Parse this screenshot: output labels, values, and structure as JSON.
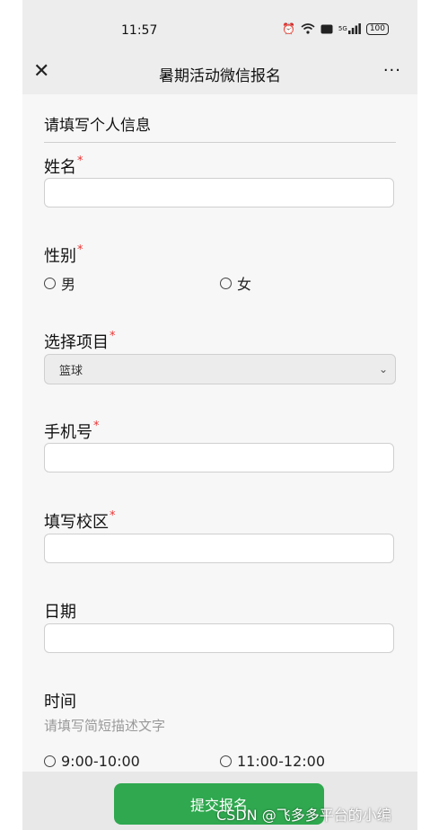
{
  "status": {
    "time": "11:57",
    "battery": "100",
    "icons": [
      "alarm-icon",
      "wifi-icon",
      "hd-icon",
      "signal-icon",
      "battery-icon"
    ],
    "signal_text": "5G"
  },
  "navbar": {
    "close_icon": "close-icon",
    "title": "暑期活动微信报名",
    "more_icon": "more-icon",
    "more_glyph": "···"
  },
  "form": {
    "section_title": "请填写个人信息",
    "name": {
      "label": "姓名",
      "required_mark": "*",
      "value": ""
    },
    "gender": {
      "label": "性别",
      "required_mark": "*",
      "options": [
        "男",
        "女"
      ]
    },
    "project": {
      "label": "选择项目",
      "required_mark": "*",
      "selected": "篮球"
    },
    "phone": {
      "label": "手机号",
      "required_mark": "*",
      "value": ""
    },
    "campus": {
      "label": "填写校区",
      "required_mark": "*",
      "value": ""
    },
    "date": {
      "label": "日期",
      "value": ""
    },
    "time": {
      "label": "时间",
      "hint": "请填写简短描述文字",
      "options": [
        "9:00-10:00",
        "11:00-12:00"
      ]
    }
  },
  "submit_label": "提交报名",
  "watermark": "CSDN @飞多多平台的小编",
  "colors": {
    "accent": "#2fa84f",
    "required": "#e33333"
  }
}
